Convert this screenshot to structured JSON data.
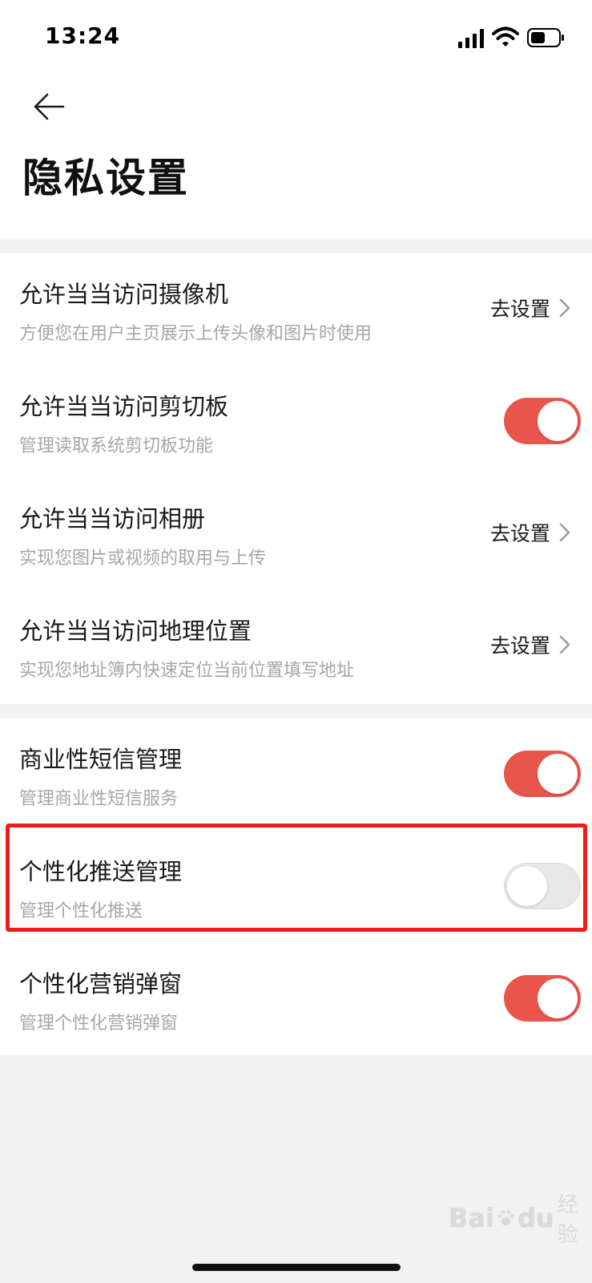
{
  "status_bar": {
    "time": "13:24",
    "icons": [
      "signal-icon",
      "wifi-icon",
      "battery-icon"
    ]
  },
  "header": {
    "back_icon": "arrow-left-icon",
    "title": "隐私设置"
  },
  "groups": [
    {
      "items": [
        {
          "title": "允许当当访问摄像机",
          "desc": "方便您在用户主页展示上传头像和图片时使用",
          "control": "link",
          "link_label": "去设置"
        },
        {
          "title": "允许当当访问剪切板",
          "desc": "管理读取系统剪切板功能",
          "control": "toggle",
          "on": true
        },
        {
          "title": "允许当当访问相册",
          "desc": "实现您图片或视频的取用与上传",
          "control": "link",
          "link_label": "去设置"
        },
        {
          "title": "允许当当访问地理位置",
          "desc": "实现您地址簿内快速定位当前位置填写地址",
          "control": "link",
          "link_label": "去设置"
        }
      ]
    },
    {
      "items": [
        {
          "title": "商业性短信管理",
          "desc": "管理商业性短信服务",
          "control": "toggle",
          "on": true
        },
        {
          "title": "个性化推送管理",
          "desc": "管理个性化推送",
          "control": "toggle",
          "on": false
        },
        {
          "title": "个性化营销弹窗",
          "desc": "管理个性化营销弹窗",
          "control": "toggle",
          "on": true
        }
      ]
    }
  ],
  "watermark": {
    "brand": "Bai",
    "brand_suffix": "du",
    "suffix": "经验"
  },
  "colors": {
    "toggle_on": "#e9554b",
    "toggle_off": "#e8e8e8",
    "highlight": "#ee1c1c",
    "background": "#f2f2f2"
  }
}
